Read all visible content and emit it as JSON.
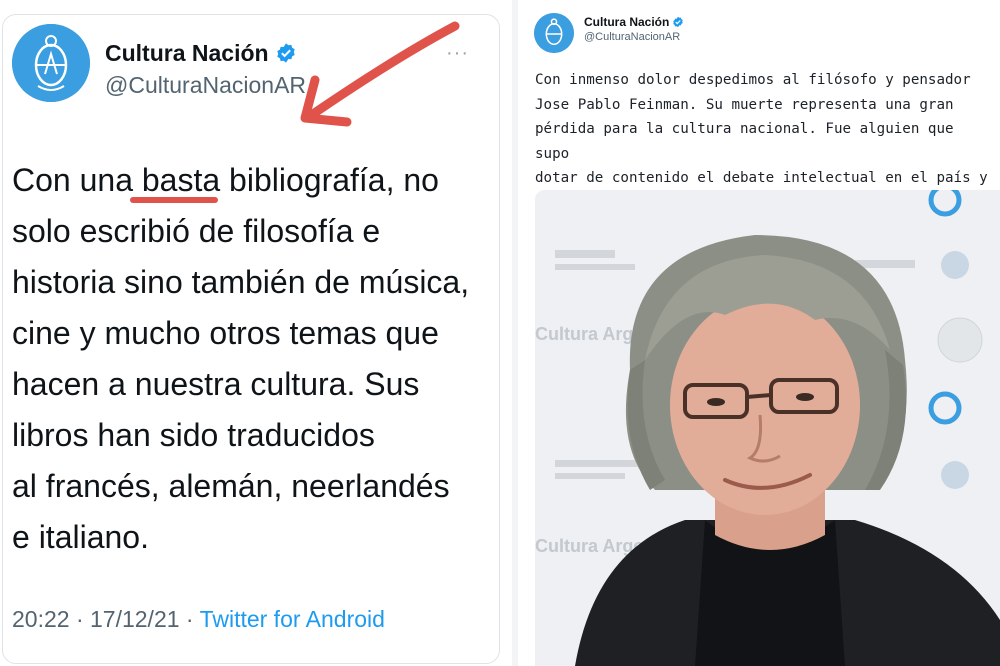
{
  "left_tweet": {
    "display_name": "Cultura Nación",
    "handle": "@CulturaNacionAR",
    "more_label": "···",
    "body": "Con una basta bibliografía, no\nsolo escribió de filosofía e\nhistoria sino también de música,\ncine y mucho otros temas que\nhacen a nuestra cultura. Sus\nlibros han sido traducidos\nal francés, alemán, neerlandés\ne italiano.",
    "timestamp": "20:22 · 17/12/21 · ",
    "source": "Twitter for Android",
    "annotation_color": "#e0534a"
  },
  "right_tweet": {
    "display_name": "Cultura Nación",
    "handle": "@CulturaNacionAR",
    "body": "Con inmenso dolor despedimos al filósofo y pensador\nJose Pablo Feinman. Su muerte representa una gran\npérdida para la cultura nacional. Fue alguien que supo\ndotar de contenido el debate intelectual en el país y\nhacernos reflexionar con sus ensayos y libros.",
    "backdrop_text": "Cultura Argentina"
  },
  "colors": {
    "accent": "#1d9bf0",
    "avatar_bg": "#3b9ee0",
    "text": "#0f1419",
    "muted": "#536471"
  },
  "icons": [
    "verified-badge-icon",
    "more-options-icon",
    "argentina-seal-icon",
    "red-arrow-annotation"
  ]
}
